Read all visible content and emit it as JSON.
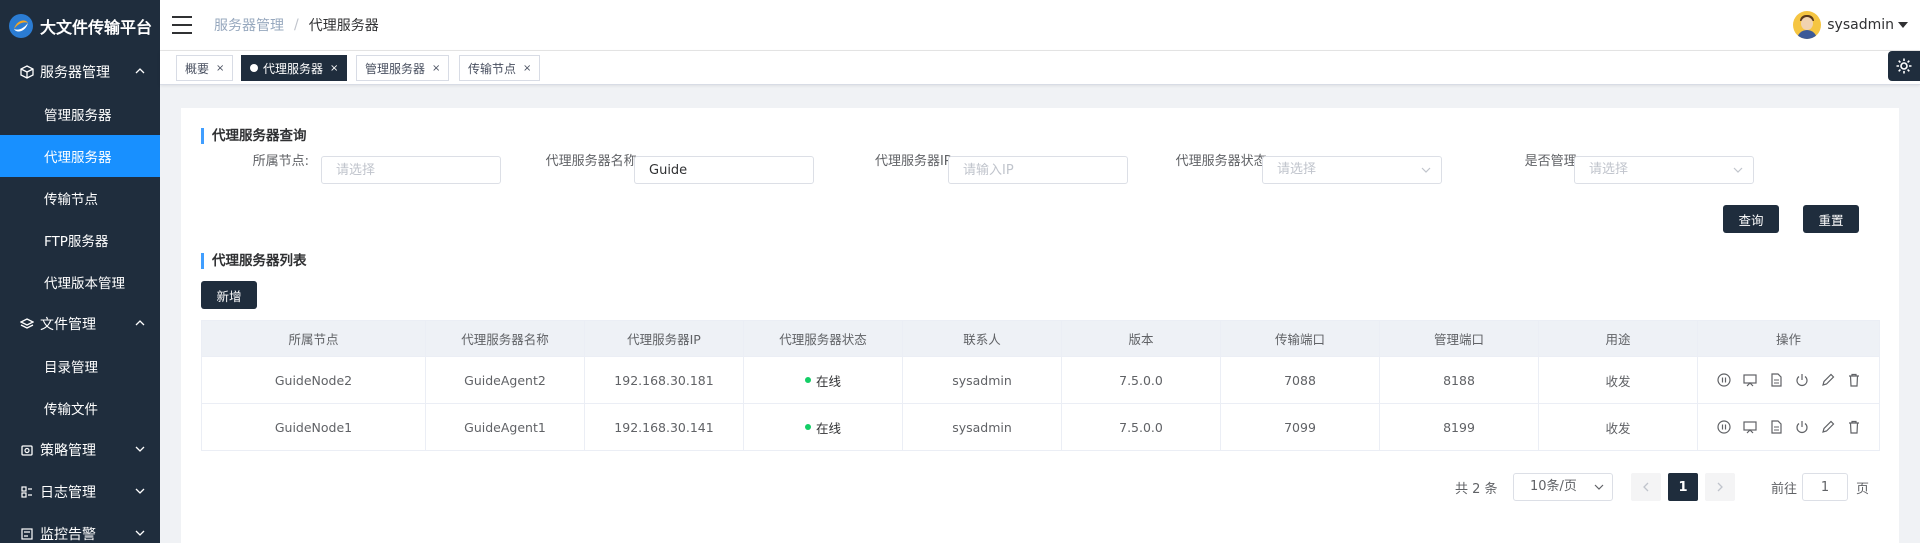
{
  "app": {
    "title": "大文件传输平台"
  },
  "sidebar": {
    "groups": [
      {
        "label": "服务器管理",
        "items": [
          "管理服务器",
          "代理服务器",
          "传输节点",
          "FTP服务器",
          "代理版本管理"
        ]
      },
      {
        "label": "文件管理",
        "items": [
          "目录管理",
          "传输文件"
        ]
      },
      {
        "label": "策略管理",
        "items": []
      },
      {
        "label": "日志管理",
        "items": []
      },
      {
        "label": "监控告警",
        "items": []
      }
    ],
    "active_item": "代理服务器",
    "active_color": "#1890ff",
    "bg_color": "#1f2d3d"
  },
  "header": {
    "breadcrumb": [
      "服务器管理",
      "代理服务器"
    ],
    "breadcrumb_sep": "/",
    "user": "sysadmin"
  },
  "tags": [
    {
      "label": "概要",
      "active": false,
      "close": "×"
    },
    {
      "label": "代理服务器",
      "active": true,
      "close": "×"
    },
    {
      "label": "管理服务器",
      "active": false,
      "close": "×"
    },
    {
      "label": "传输节点",
      "active": false,
      "close": "×"
    }
  ],
  "query": {
    "title": "代理服务器查询",
    "node_label": "所属节点:",
    "node_placeholder": "请选择",
    "name_label": "代理服务器名称:",
    "name_value": "Guide",
    "ip_label": "代理服务器IP:",
    "ip_placeholder": "请输入IP",
    "status_label": "代理服务器状态:",
    "status_placeholder": "请选择",
    "managed_label": "是否管理:",
    "managed_placeholder": "请选择",
    "search_button": "查询",
    "reset_button": "重置"
  },
  "list": {
    "title": "代理服务器列表",
    "add_button": "新增",
    "columns": [
      "所属节点",
      "代理服务器名称",
      "代理服务器IP",
      "代理服务器状态",
      "联系人",
      "版本",
      "传输端口",
      "管理端口",
      "用途",
      "操作"
    ],
    "rows": [
      [
        "GuideNode2",
        "GuideAgent2",
        "192.168.30.181",
        "在线",
        "sysadmin",
        "7.5.0.0",
        "7088",
        "8188",
        "收发"
      ],
      [
        "GuideNode1",
        "GuideAgent1",
        "192.168.30.141",
        "在线",
        "sysadmin",
        "7.5.0.0",
        "7099",
        "8199",
        "收发"
      ]
    ],
    "status_color": "#13ce66",
    "ops_icons": [
      "pause-icon",
      "monitor-icon",
      "document-icon",
      "power-icon",
      "edit-icon",
      "delete-icon"
    ]
  },
  "pagination": {
    "total": "共 2 条",
    "page_size": "10条/页",
    "current_page": "1",
    "goto_label": "前往",
    "goto_value": "1",
    "page_suffix": "页"
  },
  "colors": {
    "accent": "#409eff",
    "dark": "#1f2d3d"
  }
}
